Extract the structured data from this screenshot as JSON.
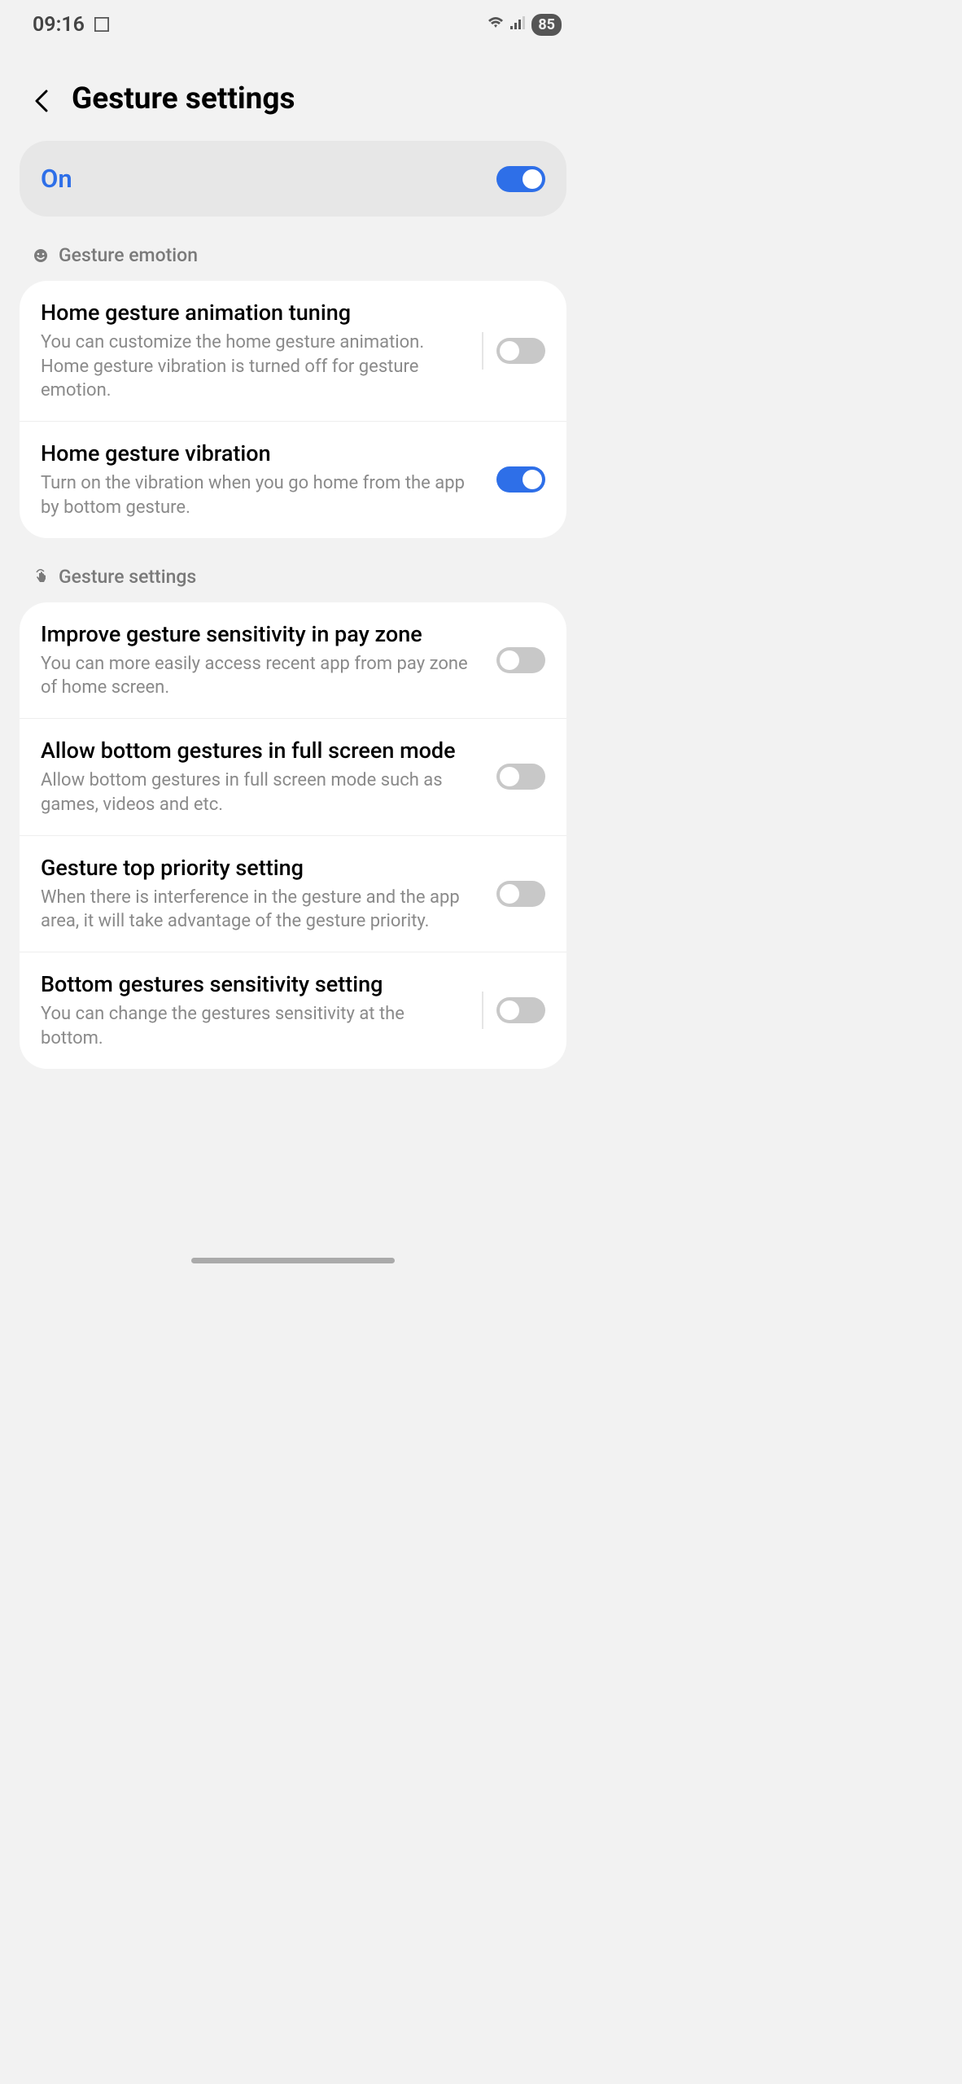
{
  "status": {
    "time": "09:16",
    "battery": "85"
  },
  "header": {
    "title": "Gesture settings"
  },
  "master": {
    "label": "On",
    "state": true
  },
  "sections": [
    {
      "title": "Gesture emotion",
      "icon": "face-icon",
      "rows": [
        {
          "title": "Home gesture animation tuning",
          "desc": "You can customize the home gesture animation. Home gesture vibration is turned off for gesture emotion.",
          "toggle": false,
          "divider": true
        },
        {
          "title": "Home gesture vibration",
          "desc": "Turn on the vibration when you go home from the app by bottom gesture.",
          "toggle": true,
          "divider": false
        }
      ]
    },
    {
      "title": "Gesture settings",
      "icon": "touch-icon",
      "rows": [
        {
          "title": "Improve gesture sensitivity in pay zone",
          "desc": "You can more easily access recent app from pay zone of home screen.",
          "toggle": false,
          "divider": false
        },
        {
          "title": "Allow bottom gestures in full screen mode",
          "desc": "Allow bottom gestures in full screen mode such as games, videos and etc.",
          "toggle": false,
          "divider": false
        },
        {
          "title": "Gesture top priority setting",
          "desc": "When there is interference in the gesture and the app area, it will take advantage of the gesture priority.",
          "toggle": false,
          "divider": false
        },
        {
          "title": "Bottom gestures sensitivity setting",
          "desc": "You can change the gestures sensitivity at the bottom.",
          "toggle": false,
          "divider": true
        }
      ]
    }
  ]
}
